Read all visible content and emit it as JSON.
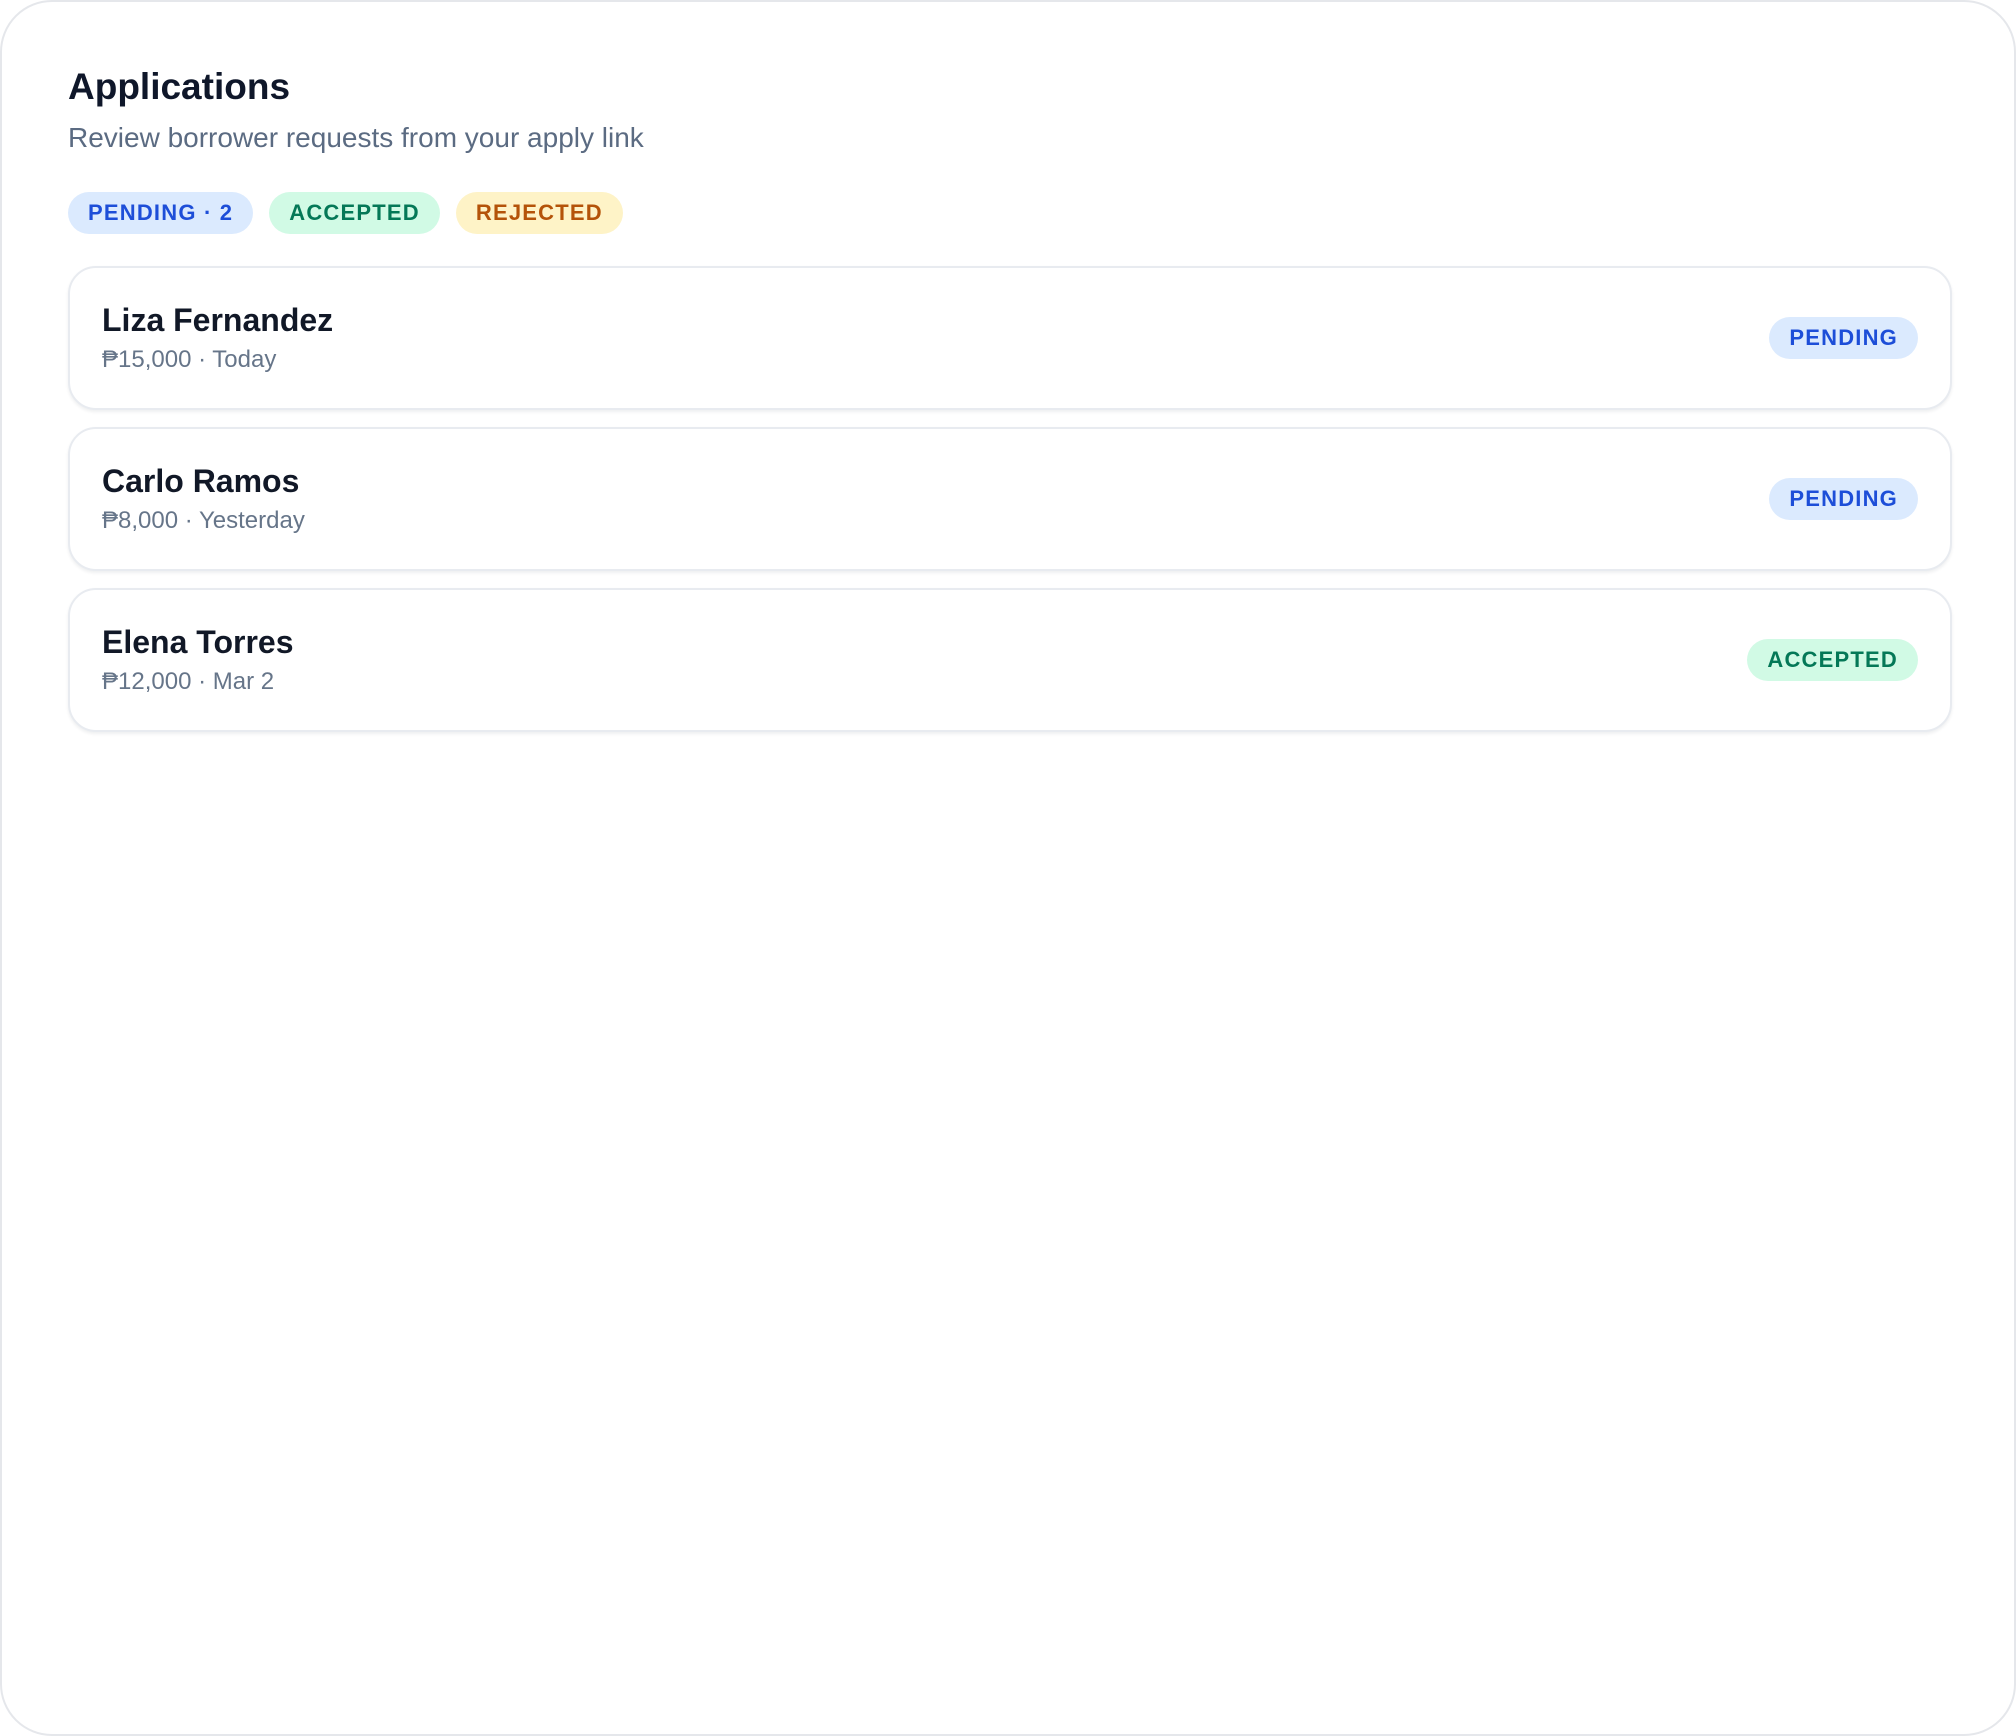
{
  "header": {
    "title": "Applications",
    "subtitle": "Review borrower requests from your apply link"
  },
  "filters": [
    {
      "label": "PENDING · 2",
      "variant": "pending"
    },
    {
      "label": "ACCEPTED",
      "variant": "accepted"
    },
    {
      "label": "REJECTED",
      "variant": "rejected"
    }
  ],
  "applications": [
    {
      "name": "Liza Fernandez",
      "meta": "₱15,000 · Today",
      "status": "PENDING"
    },
    {
      "name": "Carlo Ramos",
      "meta": "₱8,000 · Yesterday",
      "status": "PENDING"
    },
    {
      "name": "Elena Torres",
      "meta": "₱12,000 · Mar 2",
      "status": "ACCEPTED"
    }
  ],
  "colors": {
    "pending_bg": "#dbeafe",
    "pending_text": "#1d4ed8",
    "accepted_bg": "#d1fae5",
    "accepted_text": "#047857",
    "rejected_bg": "#fef3c7",
    "rejected_text": "#b45309"
  }
}
